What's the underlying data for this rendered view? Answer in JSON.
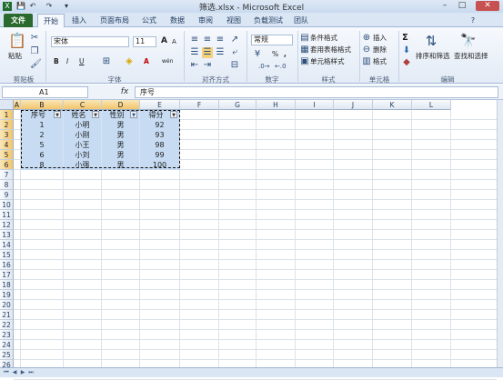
{
  "window": {
    "title": "筛选.xlsx - Microsoft Excel",
    "minimize": "–",
    "maximize": "□",
    "close": "✕"
  },
  "qat": {
    "save_icon": "💾",
    "undo_icon": "↶",
    "redo_icon": "↷",
    "customize_icon": "▾"
  },
  "ribbon": {
    "tabs": [
      "文件",
      "开始",
      "插入",
      "页面布局",
      "公式",
      "数据",
      "审阅",
      "视图",
      "负载测试",
      "团队"
    ],
    "clipboard": {
      "paste": "粘贴",
      "label": "剪贴板"
    },
    "font": {
      "name": "宋体",
      "size": "11",
      "grow": "A",
      "shrink": "A",
      "bold": "B",
      "italic": "I",
      "underline": "U",
      "font_color": "A",
      "wen": "wén",
      "label": "字体"
    },
    "alignment": {
      "label": "对齐方式"
    },
    "number": {
      "format": "常规",
      "percent": "%",
      "comma": ",",
      "label": "数字"
    },
    "styles": {
      "conditional": "条件格式",
      "table": "套用表格格式",
      "cell": "单元格样式",
      "label": "样式"
    },
    "cells": {
      "insert": "插入",
      "delete": "删除",
      "format": "格式",
      "label": "单元格"
    },
    "editing": {
      "sum": "Σ",
      "sort": "排序和筛选",
      "find": "查找和选择",
      "label": "编辑"
    }
  },
  "formula_bar": {
    "name_box": "A1",
    "fx": "fx",
    "value": "序号"
  },
  "sheet": {
    "columns": [
      "A",
      "B",
      "C",
      "D",
      "E",
      "F",
      "G",
      "H",
      "I",
      "J",
      "K",
      "L"
    ],
    "rows": [
      "1",
      "2",
      "3",
      "4",
      "5",
      "6",
      "7",
      "8",
      "9",
      "10",
      "11",
      "12",
      "13",
      "14",
      "15",
      "16",
      "17",
      "18",
      "19",
      "20",
      "21",
      "22",
      "23",
      "24",
      "25",
      "26"
    ],
    "headers": [
      "序号",
      "姓名",
      "性别",
      "得分"
    ],
    "data": [
      [
        "1",
        "小明",
        "男",
        "92"
      ],
      [
        "2",
        "小刚",
        "男",
        "93"
      ],
      [
        "5",
        "小王",
        "男",
        "98"
      ],
      [
        "6",
        "小刘",
        "男",
        "99"
      ],
      [
        "8",
        "小强",
        "男",
        "100"
      ]
    ],
    "filter_arrow": "▼",
    "filter_active_icon": "funnel-icon"
  },
  "colors": {
    "selection": "#c7dcf3",
    "file_tab": "#2a6a2e",
    "header_selected": "#f2c56c"
  }
}
